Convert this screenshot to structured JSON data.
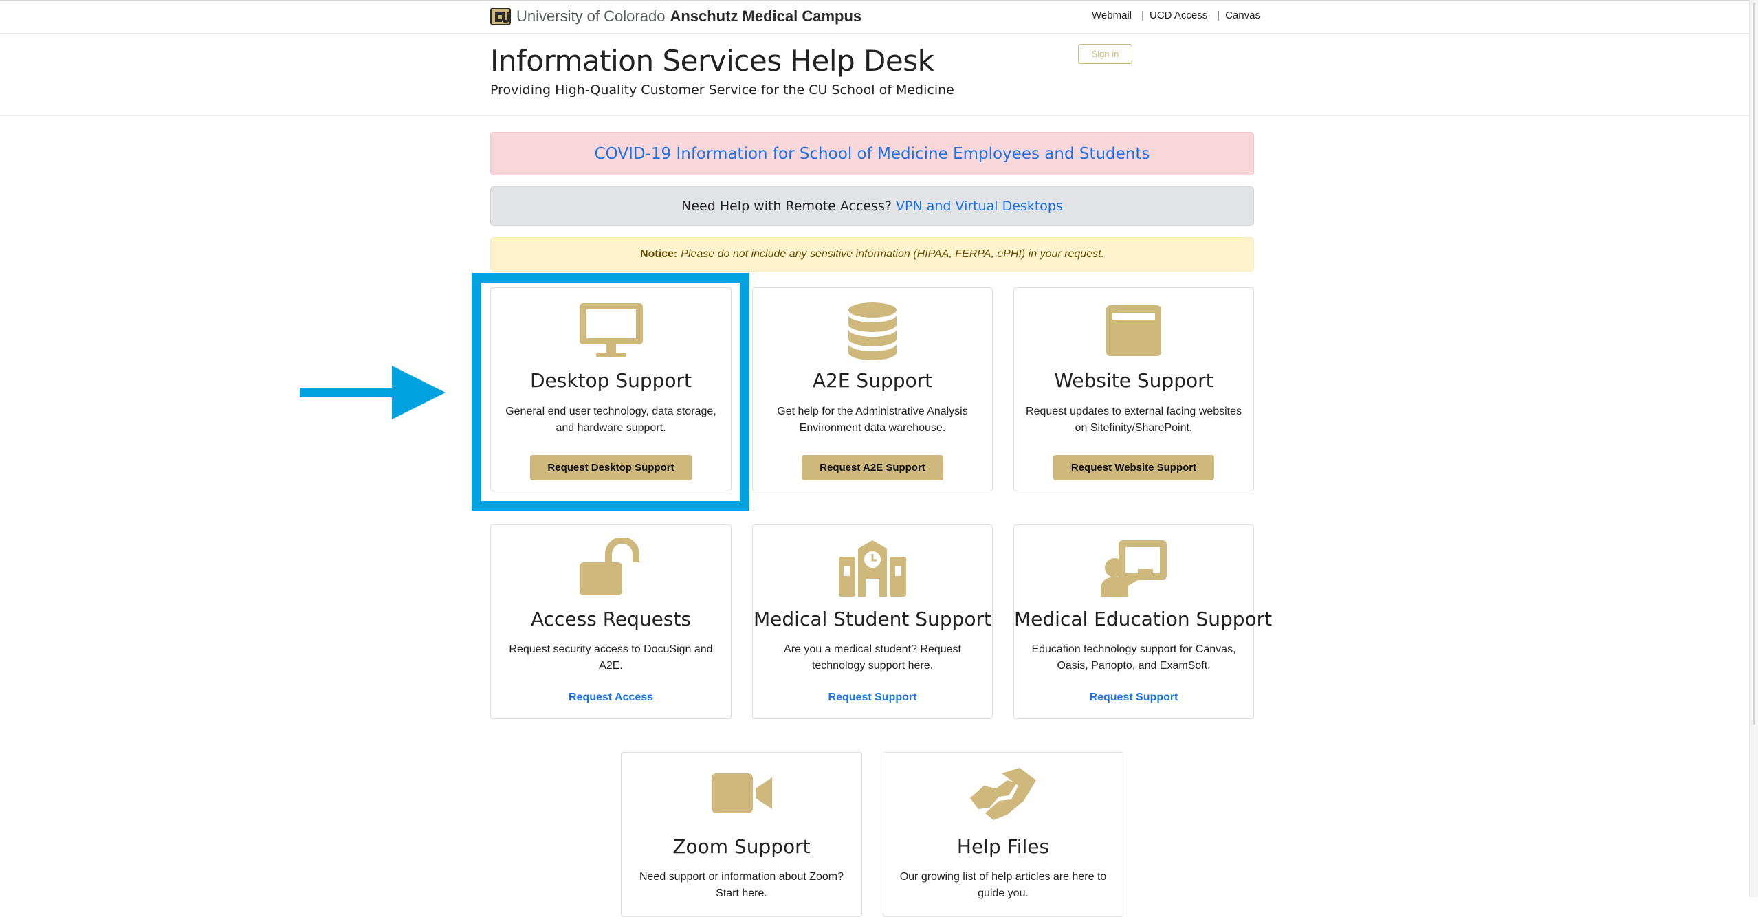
{
  "brand": {
    "university": "University of Colorado",
    "campus": "Anschutz Medical Campus",
    "gold": "#CFB87C",
    "link_blue": "#1A73E8"
  },
  "top_links": [
    {
      "label": "Webmail"
    },
    {
      "label": "UCD Access"
    },
    {
      "label": "Canvas"
    }
  ],
  "header": {
    "title": "Information Services Help Desk",
    "subtitle": "Providing High-Quality Customer Service for the CU School of Medicine",
    "sign_in": "Sign in"
  },
  "alerts": {
    "covid_link": "COVID-19 Information for School of Medicine Employees and Students",
    "remote_text": "Need Help with Remote Access?",
    "remote_link": "VPN and Virtual Desktops",
    "notice_label": "Notice:",
    "notice_text": "Please do not include any sensitive information (HIPAA, FERPA, ePHI) in your request."
  },
  "cards": [
    {
      "icon": "monitor-icon",
      "title": "Desktop Support",
      "desc": "General end user technology, data storage, and hardware support.",
      "action": "Request Desktop Support",
      "action_style": "button"
    },
    {
      "icon": "database-icon",
      "title": "A2E Support",
      "desc": "Get help for the Administrative Analysis Environment data warehouse.",
      "action": "Request A2E Support",
      "action_style": "button"
    },
    {
      "icon": "browser-window-icon",
      "title": "Website Support",
      "desc": "Request updates to external facing websites on Sitefinity/SharePoint.",
      "action": "Request Website Support",
      "action_style": "button"
    },
    {
      "icon": "unlock-icon",
      "title": "Access Requests",
      "desc": "Request security access to DocuSign and A2E.",
      "action": "Request Access",
      "action_style": "link"
    },
    {
      "icon": "school-icon",
      "title": "Medical Student Support",
      "desc": "Are you a medical student? Request technology support here.",
      "action": "Request Support",
      "action_style": "link"
    },
    {
      "icon": "teacher-board-icon",
      "title": "Medical Education Support",
      "desc": "Education technology support for Canvas, Oasis, Panopto, and ExamSoft.",
      "action": "Request Support",
      "action_style": "link"
    },
    {
      "icon": "video-camera-icon",
      "title": "Zoom Support",
      "desc": "Need support or information about Zoom? Start here.",
      "action_style": "none"
    },
    {
      "icon": "handshake-icon",
      "title": "Help Files",
      "desc": "Our growing list of help articles are here to guide you.",
      "action_style": "none"
    }
  ],
  "annotation": {
    "highlight_color": "#00A3E0",
    "highlighted_card": "Desktop Support"
  }
}
